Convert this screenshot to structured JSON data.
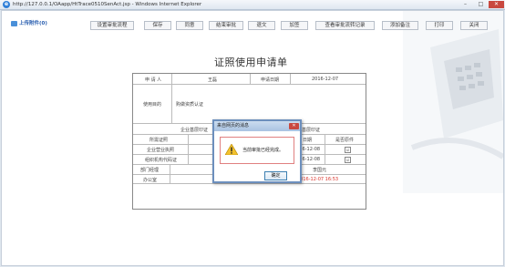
{
  "window": {
    "title": "http://127.0.0.1/OAapp/HtTrace0510SenAct.jsp - Windows Internet Explorer",
    "ie_icon": "e",
    "min": "–",
    "max": "□",
    "close": "✕"
  },
  "page": {
    "upload_label": "上传附件(0)",
    "toolbar": [
      "设置审批流程",
      "保存",
      "同意",
      "结束审批",
      "退文",
      "加签",
      "查看审批流转记录",
      "添加备注",
      "打印",
      "关闭"
    ],
    "doc_title": "证照使用申请单",
    "form": {
      "applicant_label": "申 请 人",
      "applicant_value": "王磊",
      "date_label": "申请日期",
      "date_value": "2016-12-07",
      "purpose_label": "使用目的",
      "purpose_value": "购做资质认证",
      "enterprise_label": "企业基层印证",
      "enterprise2_label": "企业基层印证",
      "col_cert": "所需证照",
      "col_date": "日期",
      "col_original": "是否原件",
      "row1_cert": "企业营业执照",
      "row1_date": "2016-12-08",
      "row2_cert": "组织机构代码证",
      "row2_date": "2016-12-08",
      "check": "☑",
      "dept_label": "部门经理",
      "dept_value": "王",
      "dept_signer": "李国元",
      "office_label": "办公室",
      "office_value": "2016-12-07 16:53"
    }
  },
  "dialog": {
    "title": "来自网页的消息",
    "close": "✕",
    "message": "当前审批已经完成。",
    "ok": "确定"
  }
}
